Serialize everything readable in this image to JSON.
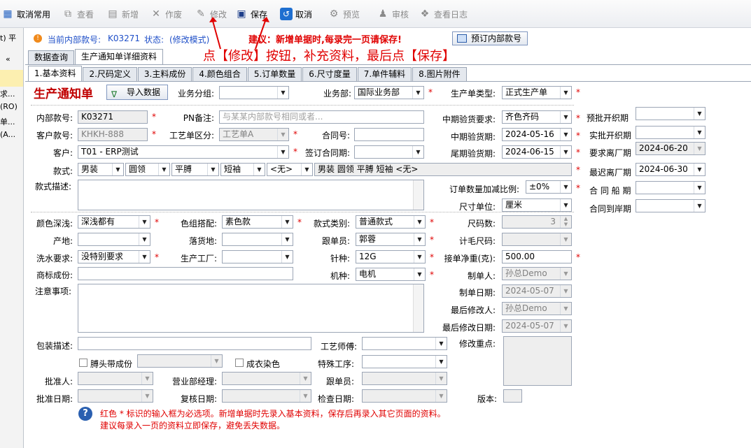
{
  "toolbar": {
    "cancel_common": "取消常用",
    "view": "查看",
    "add": "新增",
    "void": "作废",
    "edit": "修改",
    "save": "保存",
    "cancel": "取消",
    "preview": "预览",
    "audit": "审核",
    "log": "查看日志"
  },
  "left": {
    "pin": "t) 平",
    "items": [
      "求...",
      "(RO)",
      "单...",
      "(A..."
    ],
    "collapse": "«"
  },
  "info": {
    "current_label": "当前内部款号:",
    "current_value": "K03271",
    "status_label": "状态:",
    "status_value": "(修改模式)",
    "advice": "建议：新增单据时,每录完一页请保存!",
    "reserve_btn": "预订内部款号",
    "annotation": "点【修改】按钮，补充资料，最后点【保存】"
  },
  "outer_tabs": [
    "数据查询",
    "生产通知单详细资料"
  ],
  "tabs": [
    "1.基本资料",
    "2.尺码定义",
    "3.主料成份",
    "4.颜色组合",
    "5.订单数量",
    "6.尺寸度量",
    "7.单件辅料",
    "8.图片附件"
  ],
  "form": {
    "title": "生产通知单",
    "import_btn": "导入数据",
    "biz_group_label": "业务分组:",
    "biz_group": "",
    "biz_dept_label": "业务部:",
    "biz_dept": "国际业务部",
    "prod_type_label": "生产单类型:",
    "prod_type": "正式生产单",
    "inner_no_label": "内部款号:",
    "inner_no": "K03271",
    "pn_label": "PN备注:",
    "pn_placeholder": "与某某内部款号相同或者...",
    "cust_no_label": "客户款号:",
    "cust_no": "KHKH-888",
    "craft_label": "工艺单区分:",
    "craft": "工艺单A",
    "contract_label": "合同号:",
    "contract": "",
    "customer_label": "客户:",
    "customer": "T01 - ERP测试",
    "sign_label": "签订合同期:",
    "sign": "",
    "style_label": "款式:",
    "style_parts": [
      "男装",
      "圆领",
      "平膊",
      "短袖",
      "<无>"
    ],
    "style_summary": "男装 圆领 平膊 短袖 <无>",
    "style_desc_label": "款式描述:",
    "mid_req_label": "中期验货要求:",
    "mid_req": "齐色齐码",
    "mid_date_label": "中期验货期:",
    "mid_date": "2024-05-16",
    "final_date_label": "尾期验货期:",
    "final_date": "2024-06-15",
    "pre_open_label": "预批开织期",
    "pre_open": "",
    "real_open_label": "实批开织期",
    "real_open": "",
    "req_leave_label": "要求离厂期",
    "req_leave": "2024-06-20",
    "late_leave_label": "最迟离厂期",
    "late_leave": "2024-06-30",
    "ship_label": "合 同 船 期",
    "ship": "",
    "arrive_label": "合同到岸期",
    "arrive": "",
    "qty_ratio_label": "订单数量加减比例:",
    "qty_ratio": "±0%",
    "size_unit_label": "尺寸单位:",
    "size_unit": "厘米",
    "color_depth_label": "颜色深浅:",
    "color_depth": "深浅都有",
    "color_match_label": "色组搭配:",
    "color_match": "素色款",
    "style_cat_label": "款式类别:",
    "style_cat": "普通款式",
    "size_count_label": "尺码数:",
    "size_count": "3",
    "origin_label": "产地:",
    "origin": "",
    "drop_label": "落货地:",
    "drop": "",
    "follower_label": "跟单员:",
    "follower": "郭蓉",
    "hair_label": "计毛尺码:",
    "hair": "",
    "wash_label": "洗水要求:",
    "wash": "没特别要求",
    "factory_label": "生产工厂:",
    "factory": "",
    "gauge_label": "针种:",
    "gauge": "12G",
    "net_weight_label": "接单净重(克):",
    "net_weight": "500.00",
    "brand_label": "商标成份:",
    "brand": "",
    "machine_label": "机种:",
    "machine": "电机",
    "maker_label": "制单人:",
    "maker": "孙总Demo",
    "make_date_label": "制单日期:",
    "make_date": "2024-05-07",
    "notes_label": "注意事项:",
    "last_mod_label": "最后修改人:",
    "last_mod": "孙总Demo",
    "last_mod_date_label": "最后修改日期:",
    "last_mod_date": "2024-05-07",
    "pack_label": "包装描述:",
    "pack": "",
    "craftsman_label": "工艺师傅:",
    "craftsman": "",
    "focus_label": "修改重点:",
    "shoulder_chk": "膊头带成份",
    "dye_chk": "成衣染色",
    "special_label": "特殊工序:",
    "special": "",
    "approver_label": "批准人:",
    "approver": "",
    "dept_mgr_label": "营业部经理:",
    "dept_mgr": "",
    "follower2_label": "跟单员:",
    "follower2": "",
    "approve_date_label": "批准日期:",
    "approve_date": "",
    "review_date_label": "复核日期:",
    "review_date": "",
    "check_date_label": "检查日期:",
    "check_date": "",
    "version_label": "版本:",
    "version": ""
  },
  "hint": {
    "line1": "红色 * 标识的输入框为必选项。新增单据时先录入基本资料，保存后再录入其它页面的资料。",
    "line2": "建议每录入一页的资料立即保存，避免丢失数据。",
    "star": "*"
  }
}
